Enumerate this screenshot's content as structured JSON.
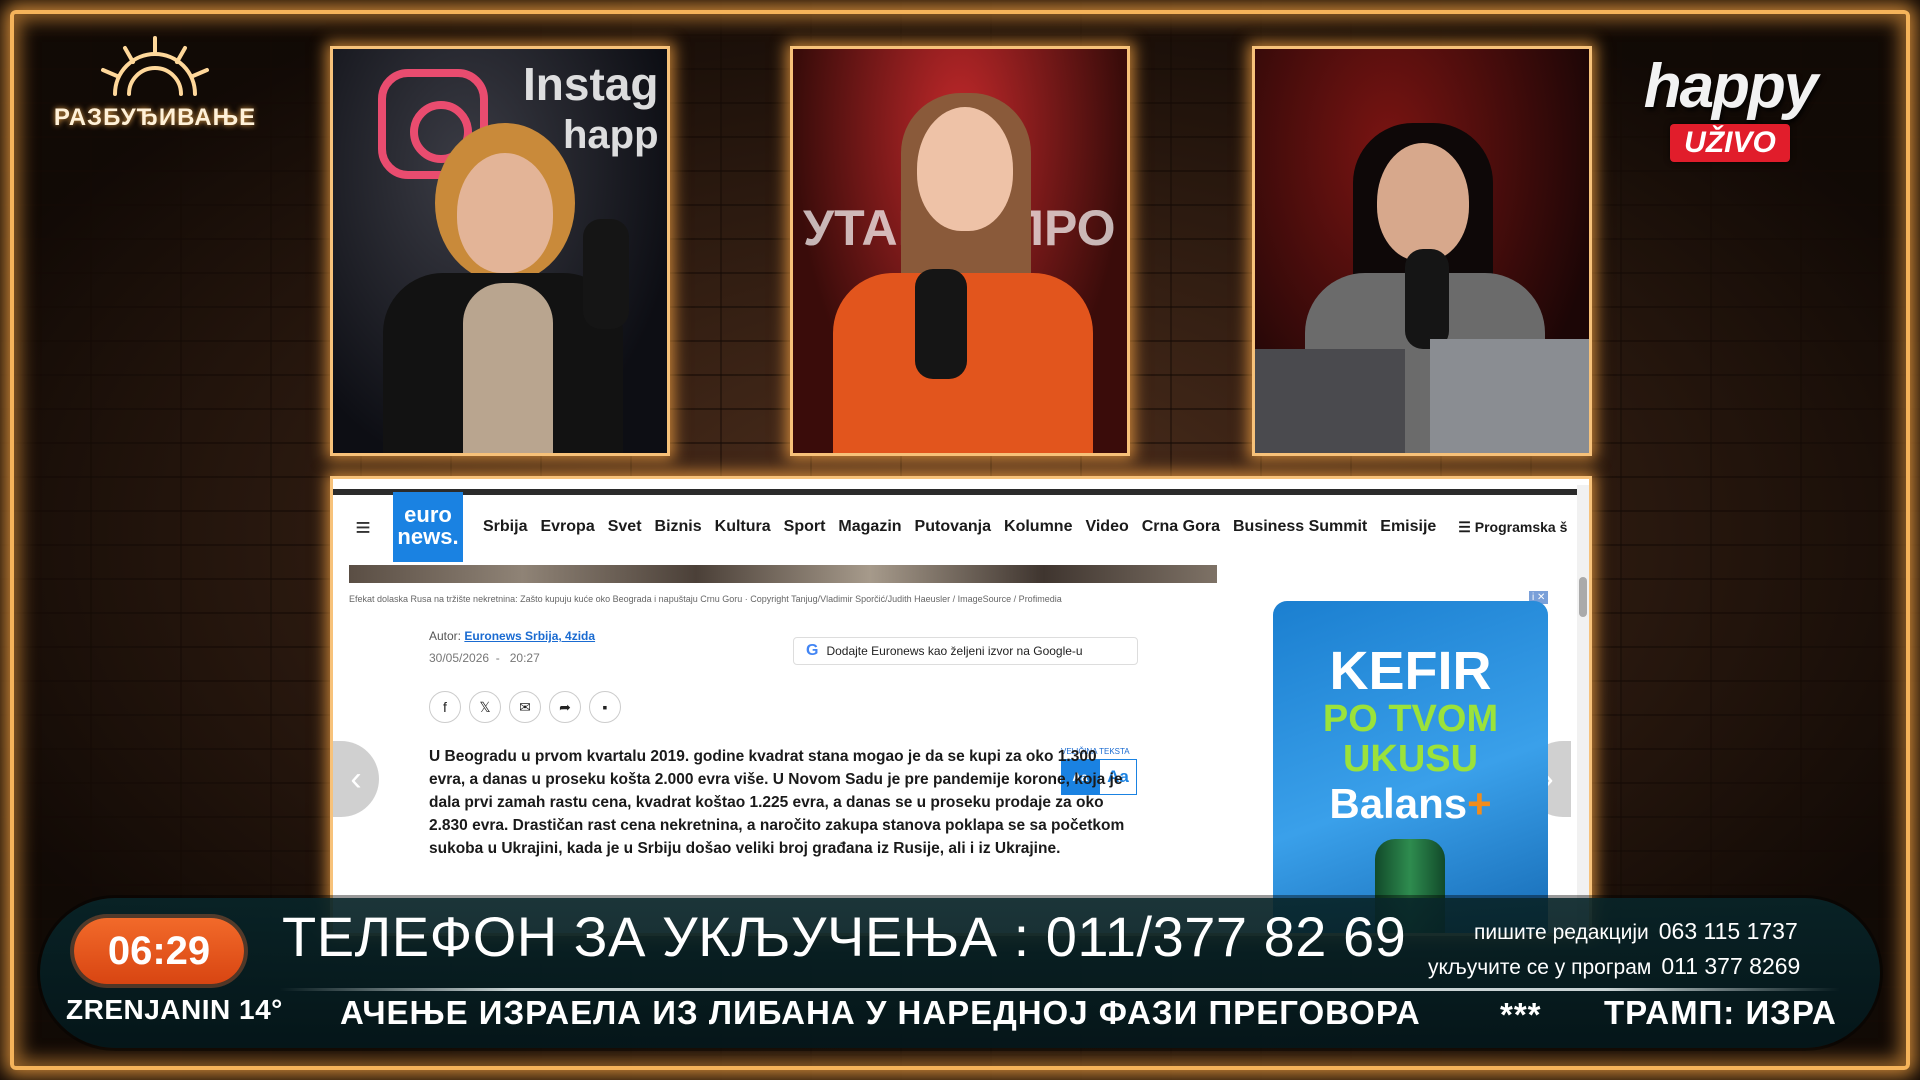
{
  "show": {
    "name": "РАЗБУЂИВАЊЕ"
  },
  "channel": {
    "name": "happy",
    "live_badge": "UŽIVO"
  },
  "panels": {
    "left_bg_text": [
      "Instag",
      "happ"
    ],
    "center_bg_text": [
      "УТАК",
      "ПРО"
    ]
  },
  "browser": {
    "brand": "euro news.",
    "menu_icon": "hamburger-menu-icon",
    "nav_items": [
      "Srbija",
      "Evropa",
      "Svet",
      "Biznis",
      "Kultura",
      "Sport",
      "Magazin",
      "Putovanja",
      "Kolumne",
      "Video",
      "Crna Gora",
      "Business Summit",
      "Emisije"
    ],
    "program_label": "Programska š",
    "caption": "Efekat dolaska Rusa na tržište nekretnina: Zašto kupuju kuće oko Beograda i napuštaju Crnu Goru · Copyright Tanjug/Vladimir Sporčić/Judith Haeusler / ImageSource / Profimedia",
    "author_label": "Autor:",
    "author_name": "Euronews Srbija, 4zida",
    "date": "30/05/2026",
    "time": "20:27",
    "google_button": "Dodajte Euronews kao željeni izvor na Google-u",
    "share_icons": [
      "facebook-icon",
      "x-icon",
      "email-icon",
      "share-icon",
      "comment-icon"
    ],
    "font_size_label": "VELIČINA TEKSTA",
    "font_small": "Aa",
    "font_large": "Aa",
    "article_text": "U Beogradu u prvom kvartalu 2019. godine kvadrat stana mogao je da se kupi za oko 1.300 evra, a danas u proseku košta 2.000 evra više. U Novom Sadu je pre pandemije korone, koja je dala prvi zamah rastu cena, kvadrat koštao 1.225 evra, a danas se u proseku prodaje za oko 2.830 evra. Drastičan rast cena nekretnina, a naročito zakupa stanova poklapa se sa početkom sukoba u Ukrajini, kada je u Srbiju došao veliki broj građana iz Rusije, ali i iz Ukrajine.",
    "ad": {
      "l1": "KEFIR",
      "l2": "PO TVOM",
      "l3": "UKUSU",
      "l4": "Balans",
      "plus": "+"
    }
  },
  "lower_third": {
    "time": "06:29",
    "weather": "ZRENJANIN 14°",
    "phone_line": "ТЕЛЕФОН ЗА УКЉУЧЕЊА : 011/377 82 69",
    "contact1_label": "пишите редакцији",
    "contact1_number": "063 115 1737",
    "contact2_label": "укључите се у програм",
    "contact2_number": "011 377 8269",
    "ticker_text": "АЧЕЊЕ ИЗРАЕЛА ИЗ ЛИБАНА У НАРЕДНОЈ ФАЗИ ПРЕГОВОРА",
    "ticker_sep": "***",
    "ticker_next": "ТРАМП: ИЗРА"
  },
  "colors": {
    "frame_glow": "#f5b35a",
    "clock": "#e5561c",
    "live_red": "#e11d2b",
    "euronews_blue": "#1a82e2"
  }
}
